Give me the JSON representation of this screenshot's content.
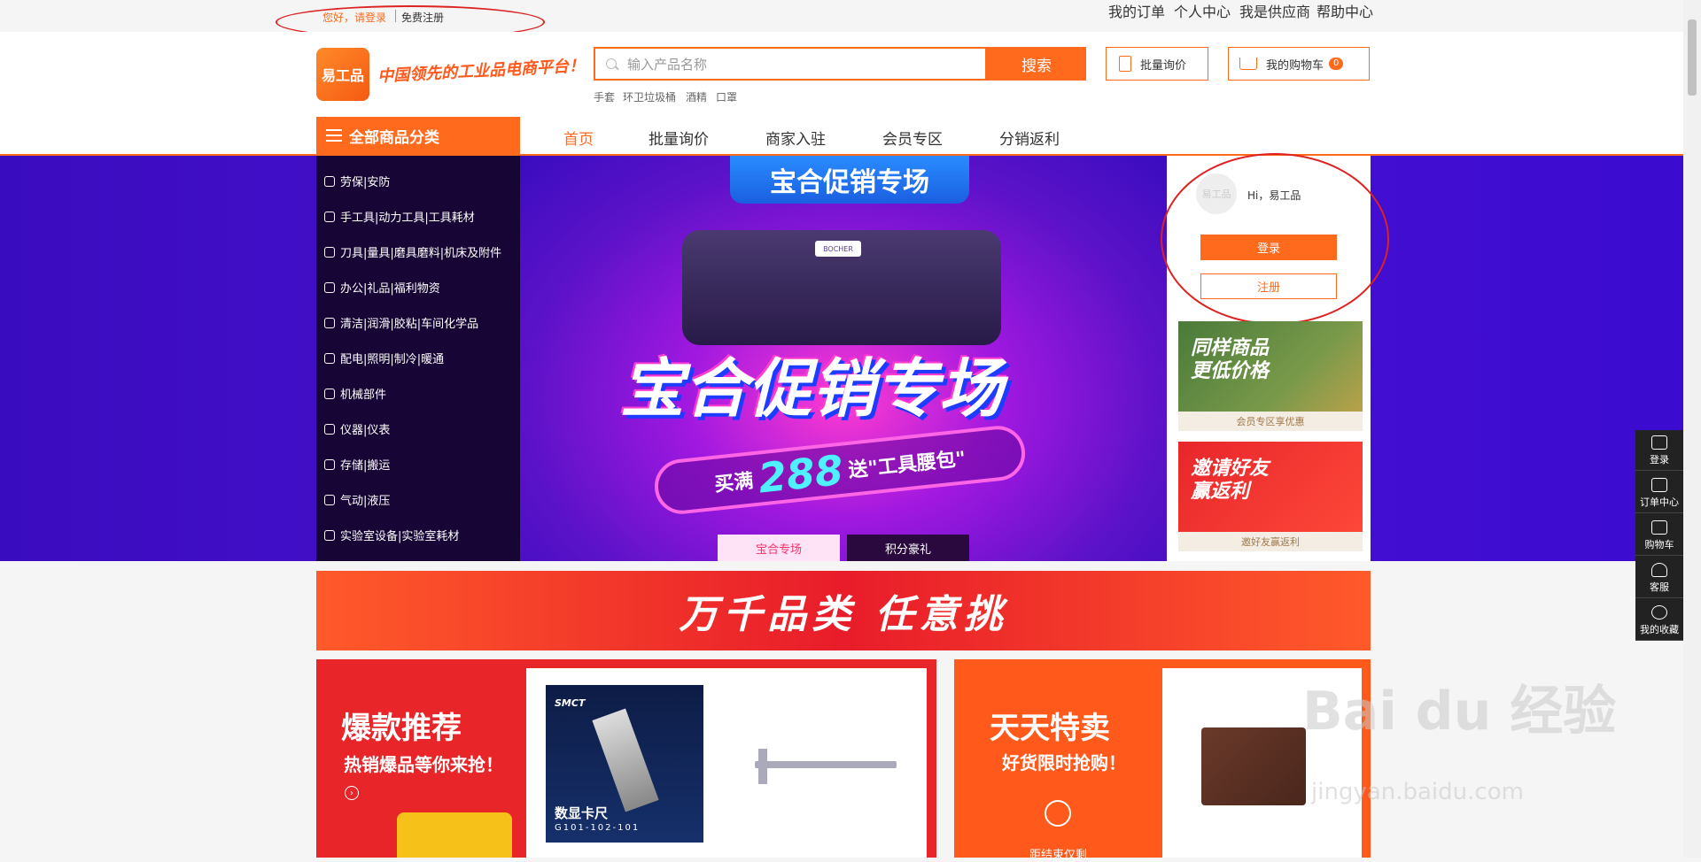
{
  "topbar": {
    "greeting": "您好，请登录",
    "register": "免费注册",
    "links": [
      "我的订单",
      "个人中心",
      "我是供应商",
      "帮助中心"
    ]
  },
  "header": {
    "logo_text": "易工品",
    "slogan": "中国领先的工业品电商平台！",
    "search_placeholder": "输入产品名称",
    "search_button": "搜索",
    "hot_words": [
      "手套",
      "环卫垃圾桶",
      "酒精",
      "口罩"
    ],
    "batch_inquiry": "批量询价",
    "cart_label": "我的购物车",
    "cart_count": "0"
  },
  "nav": {
    "all_categories": "全部商品分类",
    "items": [
      "首页",
      "批量询价",
      "商家入驻",
      "会员专区",
      "分销返利"
    ],
    "active_index": 0
  },
  "categories": [
    "劳保|安防",
    "手工具|动力工具|工具耗材",
    "刀具|量具|磨具磨料|机床及附件",
    "办公|礼品|福利物资",
    "清洁|润滑|胶粘|车间化学品",
    "配电|照明|制冷|暖通",
    "机械部件",
    "仪器|仪表",
    "存储|搬运",
    "气动|液压",
    "实验室设备|实验室耗材"
  ],
  "banner": {
    "top_label": "宝合促销专场",
    "title": "宝合促销专场",
    "pill_prefix": "买满",
    "pill_number": "288",
    "pill_suffix": "送\"工具腰包\"",
    "belt_brand": "BOCHER",
    "tabs": [
      "宝合专场",
      "积分豪礼"
    ],
    "active_tab": 0
  },
  "user_panel": {
    "avatar_text": "易工品",
    "hi_text": "Hi，易工品",
    "login": "登录",
    "register": "注册",
    "promo1_title": "同样商品\n更低价格",
    "promo1_sub": "会员专区享优惠",
    "promo2_title": "邀请好友\n赢返利",
    "promo2_sub": "邀好友赢返利"
  },
  "float_sidebar": [
    "登录",
    "订单中心",
    "购物车",
    "客服",
    "我的收藏"
  ],
  "strip_text": "万千品类 任意挑",
  "hot_block": {
    "title": "爆款推荐",
    "sub": "热销爆品等你来抢！"
  },
  "daily_block": {
    "title": "天天特卖",
    "sub": "好货限时抢购！",
    "bottom": "距结束仅剩"
  },
  "product1": {
    "brand": "SMCT",
    "name": "数显卡尺",
    "model": "G101-102-101"
  },
  "watermark": {
    "main": "Bai du 经验",
    "sub": "jingyan.baidu.com"
  },
  "colors": {
    "accent": "#ff6a1c",
    "banner_bg": "#3a0cbf",
    "red": "#e81c2a"
  }
}
